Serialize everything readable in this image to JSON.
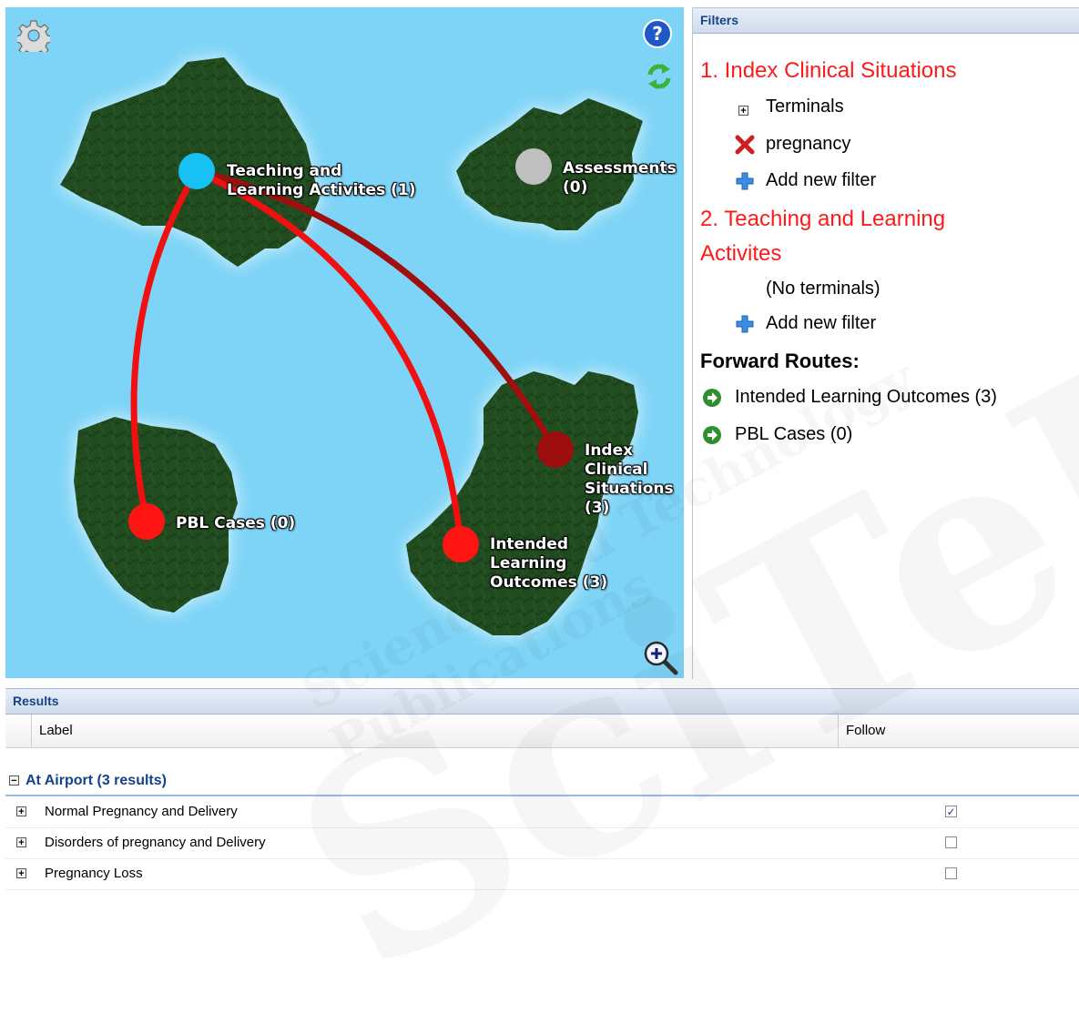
{
  "map": {
    "nodes": [
      {
        "id": "tla",
        "label": "Teaching and\nLearning Activites (1)",
        "color": "#17c1f4"
      },
      {
        "id": "assess",
        "label": "Assessments\n(0)",
        "color": "#bfbfbf"
      },
      {
        "id": "ics",
        "label": "Index\nClinical\nSituations\n(3)",
        "color": "#9e0d0d"
      },
      {
        "id": "ilo",
        "label": "Intended\nLearning\nOutcomes (3)",
        "color": "#ff1414"
      },
      {
        "id": "pbl",
        "label": "PBL Cases (0)",
        "color": "#ff1414"
      }
    ],
    "icons": {
      "settings": "gear-icon",
      "help": "help-icon",
      "refresh": "refresh-icon",
      "zoom": "zoom-in-icon"
    },
    "colors": {
      "ocean": "#7ed4f6",
      "land": "#1f4a1f",
      "route": "#f01010",
      "route_dark": "#a00e0e"
    }
  },
  "filters": {
    "header": "Filters",
    "section1": {
      "title": "1. Index Clinical Situations",
      "terminals_label": "Terminals",
      "filter_value": "pregnancy",
      "add_filter": "Add new filter"
    },
    "section2": {
      "title_line1": "2. Teaching and Learning",
      "title_line2": "Activites",
      "no_terminals": "(No terminals)",
      "add_filter": "Add new filter"
    },
    "forward": {
      "title": "Forward Routes:",
      "routes": [
        "Intended Learning Outcomes (3)",
        "PBL Cases (0)"
      ]
    }
  },
  "results": {
    "header": "Results",
    "columns": {
      "label": "Label",
      "follow": "Follow"
    },
    "group": "At Airport (3 results)",
    "rows": [
      {
        "label": "Normal Pregnancy and Delivery",
        "checked": true
      },
      {
        "label": "Disorders of pregnancy and Delivery",
        "checked": false
      },
      {
        "label": "Pregnancy Loss",
        "checked": false
      }
    ]
  },
  "watermark": [
    "SciTePress",
    "Science and Technology Publications"
  ]
}
